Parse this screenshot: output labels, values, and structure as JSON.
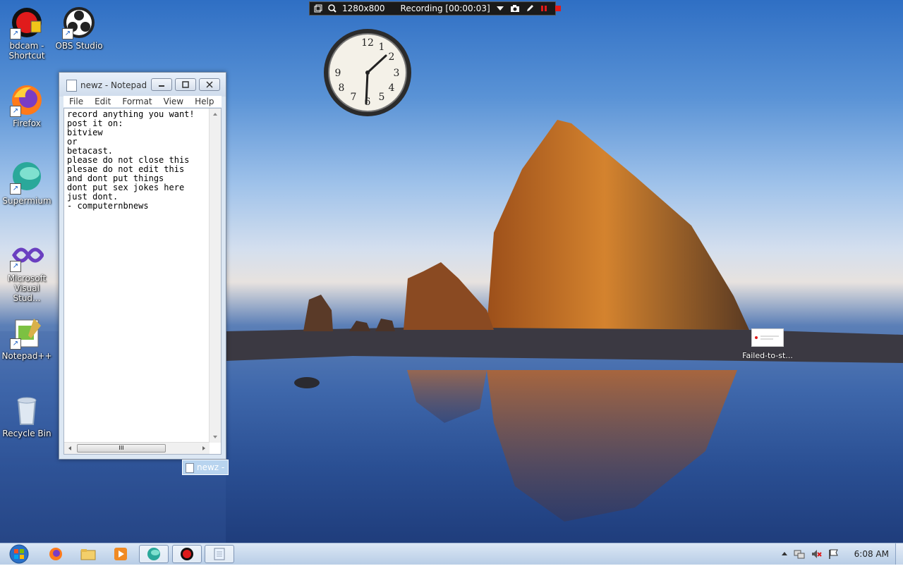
{
  "desktop_icons": [
    {
      "label": "bdcam - Shortcut",
      "icon": "bandicam-icon"
    },
    {
      "label": "OBS Studio",
      "icon": "obs-icon"
    },
    {
      "label": "Firefox",
      "icon": "firefox-icon"
    },
    {
      "label": "Supermium",
      "icon": "supermium-icon"
    },
    {
      "label": "Microsoft Visual Stud...",
      "icon": "visual-studio-icon"
    },
    {
      "label": "Notepad++",
      "icon": "notepadpp-icon"
    },
    {
      "label": "Recycle Bin",
      "icon": "recycle-bin-icon"
    }
  ],
  "recording_bar": {
    "resolution": "1280x800",
    "status": "Recording [00:00:03]"
  },
  "notepad": {
    "title": "newz - Notepad",
    "menu": [
      "File",
      "Edit",
      "Format",
      "View",
      "Help"
    ],
    "content": "record anything you want!\npost it on:\nbitview\nor\nbetacast.\nplease do not close this\nplesae do not edit this\nand dont put things\ndont put sex jokes here\njust dont.\n- computernbnews",
    "scroll_thumb": "III"
  },
  "notepad_preview_label": "newz - N",
  "failed_file": {
    "label": "Failed-to-st..."
  },
  "taskbar": {
    "pinned": [
      "firefox",
      "explorer",
      "media-player",
      "supermium",
      "bandicam",
      "notepad"
    ],
    "clock": "6:08 AM"
  },
  "colors": {
    "record_red": "#e01b1b",
    "taskbar": "#c8d9ee"
  }
}
